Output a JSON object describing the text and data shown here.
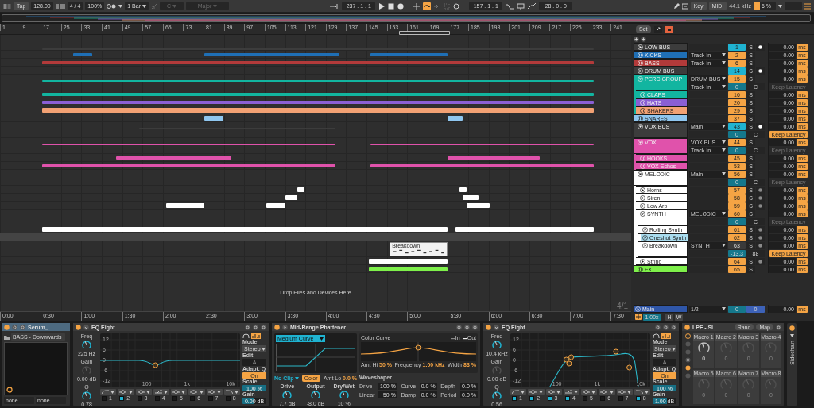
{
  "transport": {
    "tap": "Tap",
    "tempo": "128.00",
    "signature": "4 / 4",
    "zoom": "100%",
    "quantize": "1 Bar",
    "key": "C",
    "scale": "Major",
    "key_disabled": true,
    "position": "237 . 1 . 1",
    "loop_on": true,
    "loop_start": "157 . 1 . 1",
    "loop_length": "28 . 0 . 0",
    "key_button": "Key",
    "midi_button": "MIDI",
    "sample_rate": "44.1 kHz",
    "cpu": "6 %"
  },
  "ruler": {
    "set_button": "Set",
    "bars": [
      "1",
      "9",
      "17",
      "25",
      "33",
      "41",
      "49",
      "57",
      "65",
      "73",
      "81",
      "89",
      "97",
      "105",
      "113",
      "121",
      "129",
      "137",
      "145",
      "153",
      "161",
      "169",
      "177",
      "185",
      "193",
      "201",
      "209",
      "217",
      "225",
      "233",
      "241"
    ]
  },
  "arrangement": {
    "drop_hint": "Drop Files and Devices Here",
    "grid": "4/1",
    "times": [
      "0:00",
      "0:30",
      "1:00",
      "1:30",
      "2:00",
      "2:30",
      "3:00",
      "3:30",
      "4:00",
      "4:30",
      "5:00",
      "5:30",
      "6:00",
      "6:30",
      "7:00",
      "7:30"
    ]
  },
  "tracks": [
    {
      "name": "LOW BUS",
      "kind": "group",
      "expanded": false,
      "color": "#3c3c3c",
      "selected": false,
      "number": "1",
      "active": true,
      "highlighted": true,
      "solo": "S",
      "monitor_on": true,
      "delay": "0.00",
      "unit": "ms"
    },
    {
      "name": "KICKS",
      "kind": "audio",
      "color": "#1f6fb5",
      "selected": false,
      "output": "Track In",
      "number": "2",
      "active": true,
      "solo": "S",
      "delay": "0.00",
      "unit": "ms"
    },
    {
      "name": "BASS",
      "kind": "audio",
      "color": "#b23a3a",
      "selected": false,
      "output": "Track In",
      "number": "6",
      "active": true,
      "solo": "S",
      "delay": "0.00",
      "unit": "ms"
    },
    {
      "name": "DRUM BUS",
      "kind": "group",
      "expanded": false,
      "color": "#3c3c3c",
      "selected": false,
      "number": "14",
      "active": true,
      "highlighted": true,
      "solo": "S",
      "monitor_on": true,
      "delay": "0.00",
      "unit": "ms"
    },
    {
      "name": "PERC GROUP",
      "kind": "group",
      "expanded": true,
      "color": "#12b5a0",
      "selected": false,
      "output": "DRUM BUS",
      "number": "15",
      "active": true,
      "solo": "S",
      "delay": "0.00",
      "unit": "ms",
      "second": {
        "input": "Track In",
        "pan": "0",
        "center": "C",
        "latency": "Keep Latency",
        "latency_on": false
      },
      "children": [
        {
          "name": "CLAPS",
          "kind": "audio",
          "color": "#12b5a0",
          "selected": false,
          "number": "16",
          "active": true,
          "solo": "S",
          "delay": "0.00",
          "unit": "ms"
        },
        {
          "name": "HATS",
          "kind": "audio",
          "color": "#8a5fd4",
          "selected": false,
          "number": "20",
          "active": true,
          "solo": "S",
          "delay": "0.00",
          "unit": "ms"
        },
        {
          "name": "SHAKERS",
          "kind": "audio",
          "color": "#f2a173",
          "selected": false,
          "number": "29",
          "active": true,
          "solo": "S",
          "delay": "0.00",
          "unit": "ms"
        }
      ]
    },
    {
      "name": "SNARES",
      "kind": "audio",
      "color": "#8fc6ef",
      "selected": false,
      "number": "37",
      "active": true,
      "solo": "S",
      "delay": "0.00",
      "unit": "ms"
    },
    {
      "name": "VOX BUS",
      "kind": "group",
      "expanded": true,
      "color": "#3c3c3c",
      "selected": false,
      "output": "Main",
      "number": "43",
      "active": true,
      "highlighted": true,
      "solo": "S",
      "monitor_on": true,
      "delay": "0.00",
      "unit": "ms",
      "second": {
        "pan": "0",
        "center": "C",
        "latency": "Keep Latency",
        "latency_on": true
      }
    },
    {
      "name": "VOX",
      "kind": "group",
      "expanded": true,
      "color": "#e052ab",
      "selected": false,
      "output": "VOX BUS",
      "number": "44",
      "active": true,
      "solo": "S",
      "delay": "0.00",
      "unit": "ms",
      "second": {
        "input": "Track In",
        "pan": "0",
        "center": "C",
        "latency": "Keep Latency",
        "latency_on": false
      },
      "children": [
        {
          "name": "HOOKS",
          "kind": "audio",
          "color": "#e052ab",
          "selected": false,
          "number": "45",
          "active": true,
          "solo": "S",
          "delay": "0.00",
          "unit": "ms"
        },
        {
          "name": "VOX Echos",
          "kind": "audio",
          "color": "#e052ab",
          "selected": false,
          "number": "53",
          "active": true,
          "solo": "S",
          "delay": "0.00",
          "unit": "ms"
        }
      ]
    },
    {
      "name": "MELODIC",
      "kind": "group",
      "expanded": true,
      "color": "#ffffff",
      "selected": false,
      "output": "Main",
      "number": "56",
      "active": true,
      "solo": "S",
      "delay": "0.00",
      "unit": "ms",
      "second": {
        "pan": "0",
        "center": "C",
        "latency": "Keep Latency",
        "latency_on": false
      },
      "children": [
        {
          "name": "Horns",
          "kind": "midi",
          "color": "#ffffff",
          "selected": false,
          "number": "57",
          "active": true,
          "solo": "S",
          "monitor_on": false,
          "delay": "0.00",
          "unit": "ms"
        },
        {
          "name": "Siren",
          "kind": "midi",
          "color": "#ffffff",
          "selected": false,
          "number": "58",
          "active": true,
          "solo": "S",
          "monitor_on": false,
          "delay": "0.00",
          "unit": "ms"
        },
        {
          "name": "Low Arp",
          "kind": "midi",
          "color": "#ffffff",
          "selected": false,
          "number": "59",
          "active": true,
          "solo": "S",
          "monitor_on": false,
          "delay": "0.00",
          "unit": "ms"
        },
        {
          "name": "SYNTH",
          "kind": "group",
          "expanded": true,
          "color": "#ffffff",
          "selected": false,
          "output": "MELODIC",
          "number": "60",
          "active": true,
          "solo": "S",
          "delay": "0.00",
          "unit": "ms",
          "second": {
            "pan": "0",
            "center": "C",
            "latency": "Keep Latency",
            "latency_on": false
          },
          "children": [
            {
              "name": "Rolling Synth",
              "kind": "midi",
              "color": "#ffffff",
              "selected": false,
              "number": "61",
              "active": true,
              "solo": "S",
              "monitor_on": false,
              "delay": "0.00",
              "unit": "ms"
            },
            {
              "name": "Oneshot Synth",
              "kind": "midi",
              "color": "#ffffff",
              "selected": true,
              "number": "62",
              "active": true,
              "solo": "S",
              "monitor_on": false,
              "delay": "0.00",
              "unit": "ms"
            },
            {
              "name": "Breakdown",
              "kind": "midi",
              "color": "#ffffff",
              "selected": false,
              "output": "SYNTH",
              "number": "63",
              "active": false,
              "solo": "S",
              "monitor_on": false,
              "delay": "0.00",
              "unit": "ms",
              "clip_name": "Breakdown",
              "second": {
                "pan": "-13.3",
                "center": "88",
                "latency": "Keep Latency",
                "latency_on": true
              }
            }
          ]
        },
        {
          "name": "String",
          "kind": "midi",
          "color": "#ffffff",
          "selected": false,
          "number": "64",
          "active": true,
          "solo": "S",
          "monitor_on": false,
          "delay": "0.00",
          "unit": "ms"
        }
      ]
    },
    {
      "name": "FX",
      "kind": "audio",
      "color": "#7ef04a",
      "selected": false,
      "number": "65",
      "active": true,
      "solo": "S",
      "delay": "0.00",
      "unit": "ms"
    }
  ],
  "main": {
    "name": "Main",
    "output": "1/2",
    "pan": "0",
    "volume": "0",
    "delay": "0.00",
    "unit": "ms",
    "tempo_scale": "1.00x",
    "h_button": "H",
    "w_button": "W"
  },
  "devices": [
    {
      "kind": "instrument",
      "title": "Serum_...",
      "preset": "BASS - Downwards",
      "inputs": [
        "none",
        "none"
      ]
    },
    {
      "kind": "eq",
      "title": "EQ Eight",
      "graph": {
        "kind": "dip"
      },
      "freq": {
        "label": "Freq",
        "value": "225 Hz"
      },
      "gain": {
        "label": "Gain",
        "value": "0.00 dB"
      },
      "q": {
        "label": "Q",
        "value": "0.78"
      },
      "db_labels": [
        "12",
        "6",
        "0",
        "-6",
        "-12"
      ],
      "hz_labels": [
        "100",
        "1k",
        "10k"
      ],
      "bands": [
        {
          "number": "1",
          "on": false,
          "kind": "lowcut"
        },
        {
          "number": "2",
          "on": true,
          "kind": "bell"
        },
        {
          "number": "3",
          "on": false,
          "kind": "bell"
        },
        {
          "number": "4",
          "on": false,
          "kind": "shelf"
        },
        {
          "number": "5",
          "on": false,
          "kind": "bell"
        },
        {
          "number": "6",
          "on": false,
          "kind": "bell"
        },
        {
          "number": "7",
          "on": false,
          "kind": "bell"
        },
        {
          "number": "8",
          "on": false,
          "kind": "highcut"
        }
      ],
      "mode_label": "Mode",
      "mode": "Stereo",
      "edit_label": "Edit",
      "edit": "A",
      "adapt_label": "Adapt. Q",
      "adapt": "On",
      "scale": {
        "label": "Scale",
        "value": "100 %",
        "level": 1
      },
      "out_gain": {
        "label": "Gain",
        "value": "0.00 dB",
        "level": 0.5
      }
    },
    {
      "kind": "phattener",
      "title": "Mid-Range Phattener",
      "curve": "Medium Curve",
      "clip": "No Clip",
      "color_button": "Color",
      "color_on": true,
      "amt_lo": {
        "label": "Amt Lo",
        "value": "0.0 %"
      },
      "knobs": [
        {
          "label": "Drive",
          "value": "7.7 dB"
        },
        {
          "label": "Output",
          "value": "-8.0 dB"
        },
        {
          "label": "Dry/Wet",
          "value": "10 %"
        }
      ],
      "color_curve": "Color Curve",
      "legend": [
        "In",
        "Out"
      ],
      "amt_hi": {
        "label": "Amt Hi",
        "value": "50 %"
      },
      "frequency": {
        "label": "Frequency",
        "value": "1.00 kHz"
      },
      "width": {
        "label": "Width",
        "value": "83 %"
      },
      "waveshaper": "Waveshaper",
      "shaper_params": [
        {
          "label": "Drive",
          "value": "100 %"
        },
        {
          "label": "Curve",
          "value": "0.0 %"
        },
        {
          "label": "Depth",
          "value": "0.0 %"
        },
        {
          "label": "Linear",
          "value": "50 %"
        },
        {
          "label": "Damp",
          "value": "0.0 %"
        },
        {
          "label": "Period",
          "value": "0.0 %"
        }
      ]
    },
    {
      "kind": "eq",
      "title": "EQ Eight",
      "graph": {
        "kind": "band"
      },
      "freq": {
        "label": "Freq",
        "value": "10.4 kHz"
      },
      "gain": {
        "label": "Gain",
        "value": "0.00 dB"
      },
      "q": {
        "label": "Q",
        "value": "0.56"
      },
      "db_labels": [
        "12",
        "6",
        "0",
        "-6",
        "-12"
      ],
      "hz_labels": [
        "100",
        "1k",
        "10k"
      ],
      "bands": [
        {
          "number": "1",
          "on": true,
          "kind": "lowcut"
        },
        {
          "number": "2",
          "on": true,
          "kind": "bell"
        },
        {
          "number": "3",
          "on": true,
          "kind": "bell"
        },
        {
          "number": "4",
          "on": true,
          "kind": "shelf"
        },
        {
          "number": "5",
          "on": false,
          "kind": "bell"
        },
        {
          "number": "6",
          "on": false,
          "kind": "bell"
        },
        {
          "number": "7",
          "on": false,
          "kind": "bell"
        },
        {
          "number": "8",
          "on": true,
          "kind": "highcut"
        }
      ],
      "mode_label": "Mode",
      "mode": "Stereo",
      "edit_label": "Edit",
      "edit": "A",
      "adapt_label": "Adapt. Q",
      "adapt": "On",
      "scale": {
        "label": "Scale",
        "value": "100 %",
        "level": 1
      },
      "out_gain": {
        "label": "Gain",
        "value": "1.00 dB",
        "level": 0.6
      }
    },
    {
      "kind": "rack",
      "title": "LPF - SL",
      "rand": "Rand",
      "map": "Map",
      "sidechain": "Sidechain",
      "macros": [
        {
          "label": "Macro 1",
          "value": "0",
          "mapped": true
        },
        {
          "label": "Macro 2",
          "value": "0",
          "mapped": false
        },
        {
          "label": "Macro 3",
          "value": "0",
          "mapped": false
        },
        {
          "label": "Macro 4",
          "value": "0",
          "mapped": false
        },
        {
          "label": "Macro 5",
          "value": "0",
          "mapped": false
        },
        {
          "label": "Macro 6",
          "value": "0",
          "mapped": false
        },
        {
          "label": "Macro 7",
          "value": "0",
          "mapped": false
        },
        {
          "label": "Macro 8",
          "value": "0",
          "mapped": false
        }
      ]
    }
  ]
}
